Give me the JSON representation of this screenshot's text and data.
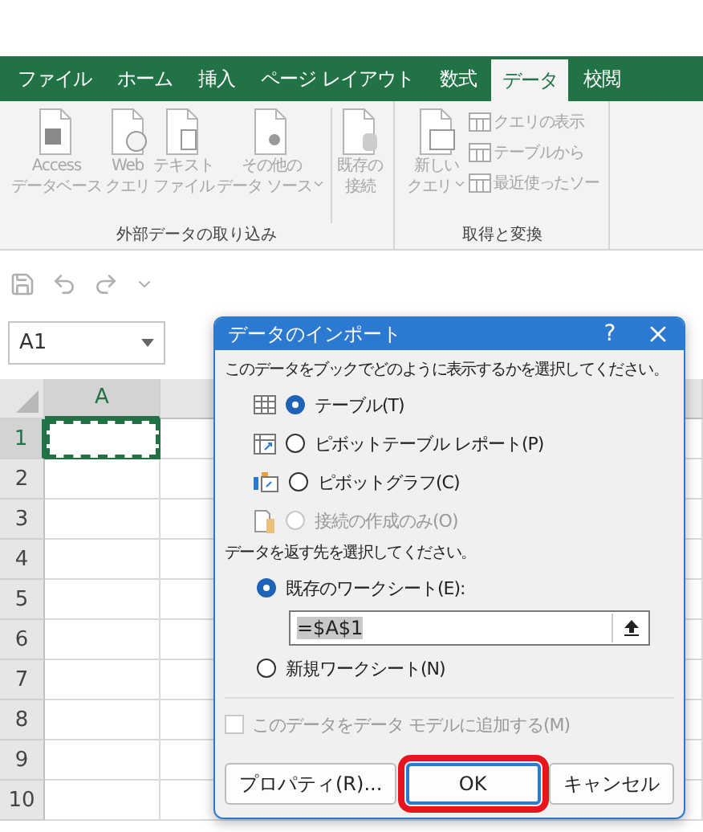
{
  "ribbon_tabs": [
    {
      "label": "ファイル",
      "selected": false
    },
    {
      "label": "ホーム",
      "selected": false
    },
    {
      "label": "挿入",
      "selected": false
    },
    {
      "label": "ページ レイアウト",
      "selected": false
    },
    {
      "label": "数式",
      "selected": false
    },
    {
      "label": "データ",
      "selected": true
    },
    {
      "label": "校閲",
      "selected": false
    }
  ],
  "ribbon_groups": [
    {
      "label": "外部データの取り込み",
      "sections": [
        [
          {
            "kind": "large",
            "lines": [
              "Access",
              "データベース"
            ],
            "dropdown": false
          },
          {
            "kind": "large",
            "lines": [
              "Web",
              "クエリ"
            ],
            "dropdown": false
          },
          {
            "kind": "large",
            "lines": [
              "テキスト",
              "ファイル"
            ],
            "dropdown": false
          },
          {
            "kind": "large",
            "lines": [
              "その他の",
              "データ ソース"
            ],
            "dropdown": true
          }
        ],
        [
          {
            "kind": "large",
            "lines": [
              "既存の",
              "接続"
            ],
            "dropdown": false
          }
        ]
      ]
    },
    {
      "label": "取得と変換",
      "sections": [
        [
          {
            "kind": "large",
            "lines": [
              "新しい",
              "クエリ"
            ],
            "dropdown": true
          },
          {
            "kind": "small",
            "lines": [
              "クエリの表示"
            ],
            "dropdown": false
          },
          {
            "kind": "small",
            "lines": [
              "テーブルから"
            ],
            "dropdown": false
          },
          {
            "kind": "small",
            "lines": [
              "最近使ったソー"
            ],
            "dropdown": false
          }
        ]
      ]
    }
  ],
  "name_box": {
    "value": "A1"
  },
  "grid": {
    "columns": [
      {
        "label": "A",
        "selected": true
      }
    ],
    "rows": [
      {
        "label": "1",
        "selected": true
      },
      {
        "label": "2",
        "selected": false
      },
      {
        "label": "3",
        "selected": false
      },
      {
        "label": "4",
        "selected": false
      },
      {
        "label": "5",
        "selected": false
      },
      {
        "label": "6",
        "selected": false
      },
      {
        "label": "7",
        "selected": false
      },
      {
        "label": "8",
        "selected": false
      },
      {
        "label": "9",
        "selected": false
      },
      {
        "label": "10",
        "selected": false
      }
    ]
  },
  "dialog": {
    "title": "データのインポート",
    "help": "?",
    "display_prompt": "このデータをブックでどのように表示するかを選択してください。",
    "display_options": [
      {
        "label": "テーブル(T)",
        "selected": true,
        "disabled": false
      },
      {
        "label": "ピボットテーブル レポート(P)",
        "selected": false,
        "disabled": false
      },
      {
        "label": "ピボットグラフ(C)",
        "selected": false,
        "disabled": false
      },
      {
        "label": "接続の作成のみ(O)",
        "selected": false,
        "disabled": true
      }
    ],
    "destination_prompt": "データを返す先を選択してください。",
    "destination_options": [
      {
        "label": "既存のワークシート(E):",
        "selected": true,
        "field": {
          "value": "=$A$1"
        }
      },
      {
        "label": "新規ワークシート(N)",
        "selected": false
      }
    ],
    "data_model_checkbox": {
      "label": "このデータをデータ モデルに追加する(M)",
      "checked": false,
      "disabled": true
    },
    "buttons": [
      {
        "label": "プロパティ(R)...",
        "default": false,
        "highlighted": false
      },
      {
        "label": "OK",
        "default": true,
        "highlighted": true
      },
      {
        "label": "キャンセル",
        "default": false,
        "highlighted": false
      }
    ]
  }
}
